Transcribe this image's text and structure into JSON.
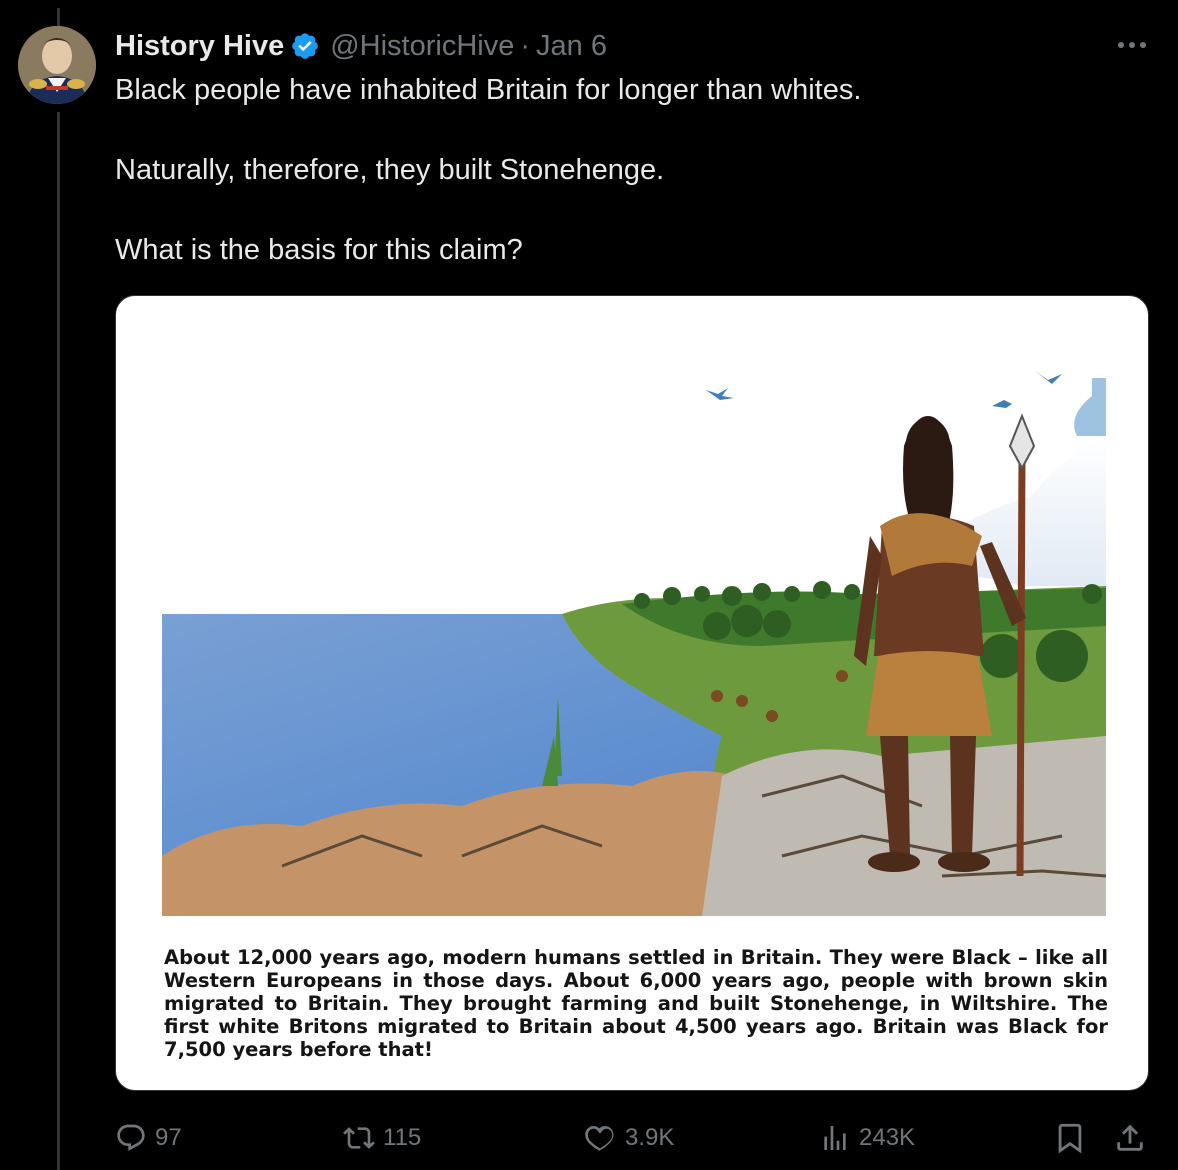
{
  "author": {
    "name": "History Hive",
    "handle": "@HistoricHive",
    "separator": "·",
    "date": "Jan 6",
    "verified_color": "#1d9bf0"
  },
  "tweet": {
    "line1": "Black people have inhabited Britain for longer than whites.",
    "line2": "Naturally, therefore, they built Stonehenge.",
    "line3": "What is the basis for this claim?"
  },
  "media": {
    "caption": "About 12,000 years ago, modern humans settled in Britain. They were Black – like all Western Europeans in those days. About 6,000 years ago, people with brown skin migrated to Britain. They brought farming and built Stonehenge, in Wiltshire. The first white Britons migrated to Britain about 4,500 years ago. Britain was Black for 7,500 years before that!"
  },
  "actions": {
    "replies": "97",
    "reposts": "115",
    "likes": "3.9K",
    "views": "243K",
    "icons": [
      "reply-icon",
      "repost-icon",
      "like-icon",
      "views-icon",
      "bookmark-icon",
      "share-icon"
    ]
  },
  "colors": {
    "background": "#000000",
    "text": "#e7e9ea",
    "muted": "#71767b"
  }
}
